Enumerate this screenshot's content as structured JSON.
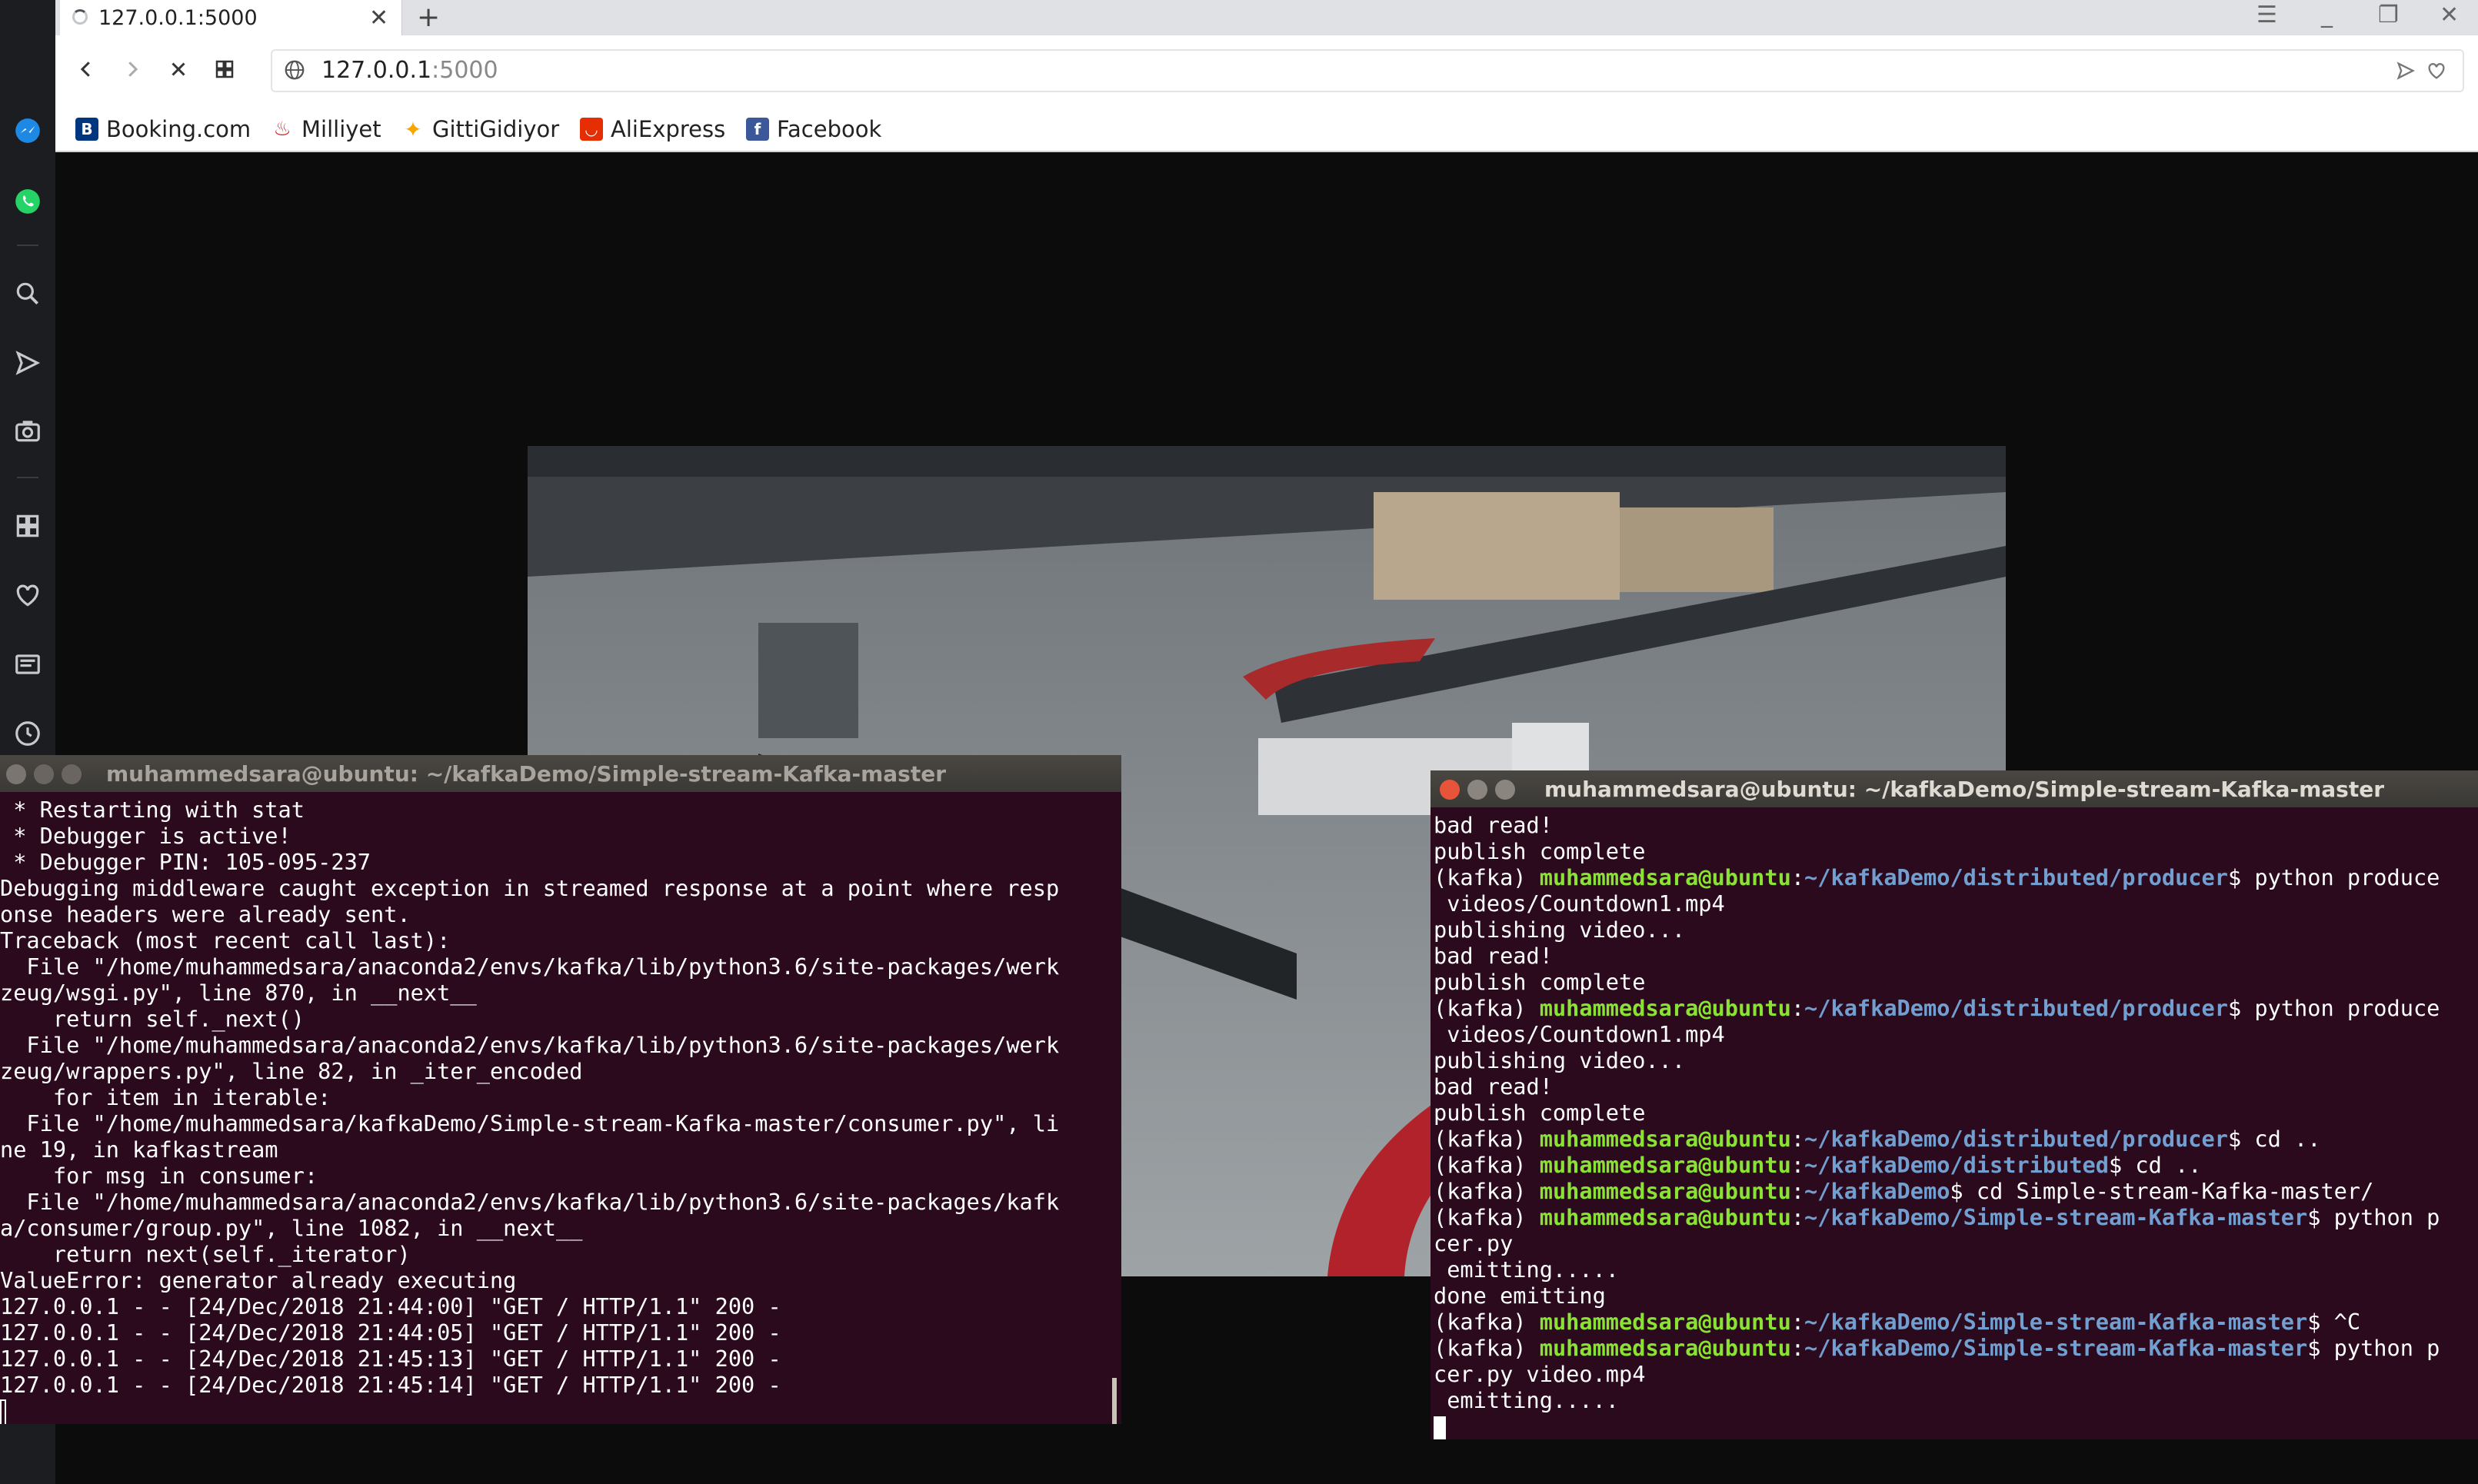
{
  "browser": {
    "tab_title": "127.0.0.1:5000",
    "url_host": "127.0.0.1",
    "url_port": ":5000",
    "bookmarks": [
      {
        "label": "Booking.com",
        "icon": "booking-icon",
        "color": "#003580",
        "glyph": "B."
      },
      {
        "label": "Milliyet",
        "icon": "milliyet-icon",
        "color": "#d71920",
        "glyph": "M"
      },
      {
        "label": "GittiGidiyor",
        "icon": "gittigidiyor-icon",
        "color": "#f7a600",
        "glyph": "✦"
      },
      {
        "label": "AliExpress",
        "icon": "aliexpress-icon",
        "color": "#e62e04",
        "glyph": "A"
      },
      {
        "label": "Facebook",
        "icon": "facebook-icon",
        "color": "#3b5998",
        "glyph": "f"
      }
    ]
  },
  "sidebar_icons": [
    "messenger-icon",
    "whatsapp-icon",
    "search-icon",
    "send-icon",
    "camera-icon",
    "speed-dial-icon",
    "heart-icon",
    "news-icon",
    "history-icon"
  ],
  "terminal_left": {
    "title": "muhammedsara@ubuntu: ~/kafkaDemo/Simple-stream-Kafka-master",
    "lines": [
      " * Restarting with stat",
      " * Debugger is active!",
      " * Debugger PIN: 105-095-237",
      "Debugging middleware caught exception in streamed response at a point where resp",
      "onse headers were already sent.",
      "Traceback (most recent call last):",
      "  File \"/home/muhammedsara/anaconda2/envs/kafka/lib/python3.6/site-packages/werk",
      "zeug/wsgi.py\", line 870, in __next__",
      "    return self._next()",
      "  File \"/home/muhammedsara/anaconda2/envs/kafka/lib/python3.6/site-packages/werk",
      "zeug/wrappers.py\", line 82, in _iter_encoded",
      "    for item in iterable:",
      "  File \"/home/muhammedsara/kafkaDemo/Simple-stream-Kafka-master/consumer.py\", li",
      "ne 19, in kafkastream",
      "    for msg in consumer:",
      "  File \"/home/muhammedsara/anaconda2/envs/kafka/lib/python3.6/site-packages/kafk",
      "a/consumer/group.py\", line 1082, in __next__",
      "    return next(self._iterator)",
      "ValueError: generator already executing",
      "127.0.0.1 - - [24/Dec/2018 21:44:00] \"GET / HTTP/1.1\" 200 -",
      "127.0.0.1 - - [24/Dec/2018 21:44:05] \"GET / HTTP/1.1\" 200 -",
      "127.0.0.1 - - [24/Dec/2018 21:45:13] \"GET / HTTP/1.1\" 200 -",
      "127.0.0.1 - - [24/Dec/2018 21:45:14] \"GET / HTTP/1.1\" 200 -"
    ]
  },
  "terminal_right": {
    "title": "muhammedsara@ubuntu: ~/kafkaDemo/Simple-stream-Kafka-master",
    "user": "muhammedsara@ubuntu",
    "env": "(kafka)",
    "lines": [
      {
        "text": "bad read!"
      },
      {
        "text": "publish complete"
      },
      {
        "path": "~/kafkaDemo/distributed/producer",
        "cmd": "$ python produce"
      },
      {
        "text": " videos/Countdown1.mp4"
      },
      {
        "text": "publishing video..."
      },
      {
        "text": "bad read!"
      },
      {
        "text": "publish complete"
      },
      {
        "path": "~/kafkaDemo/distributed/producer",
        "cmd": "$ python produce"
      },
      {
        "text": " videos/Countdown1.mp4"
      },
      {
        "text": "publishing video..."
      },
      {
        "text": "bad read!"
      },
      {
        "text": "publish complete"
      },
      {
        "path": "~/kafkaDemo/distributed/producer",
        "cmd": "$ cd .."
      },
      {
        "path": "~/kafkaDemo/distributed",
        "cmd": "$ cd .."
      },
      {
        "path": "~/kafkaDemo",
        "cmd": "$ cd Simple-stream-Kafka-master/"
      },
      {
        "path": "~/kafkaDemo/Simple-stream-Kafka-master",
        "cmd": "$ python p"
      },
      {
        "text": "cer.py"
      },
      {
        "text": " emitting....."
      },
      {
        "text": "done emitting"
      },
      {
        "path": "~/kafkaDemo/Simple-stream-Kafka-master",
        "cmd": "$ ^C"
      },
      {
        "path": "~/kafkaDemo/Simple-stream-Kafka-master",
        "cmd": "$ python p"
      },
      {
        "text": "cer.py video.mp4"
      },
      {
        "text": " emitting....."
      }
    ]
  }
}
